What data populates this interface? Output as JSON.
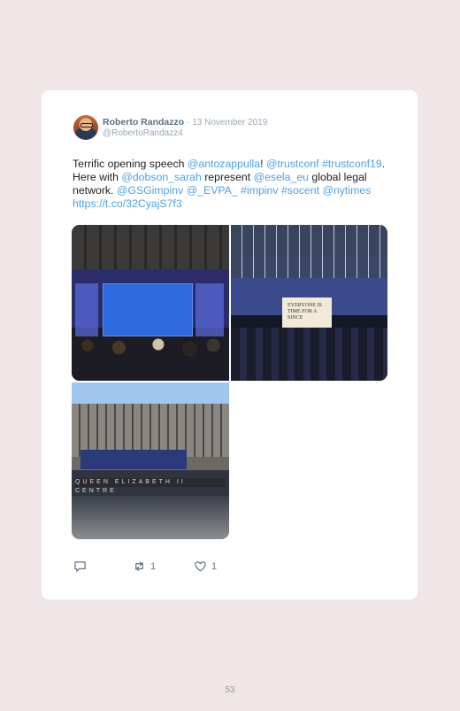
{
  "tweet": {
    "author_name": "Roberto Randazzo",
    "date": "· 13 November 2019",
    "handle": "@RobertoRandazz4",
    "text_parts": [
      {
        "t": "Terrific opening speech ",
        "link": false
      },
      {
        "t": "@antozappulla",
        "link": true
      },
      {
        "t": "! ",
        "link": false
      },
      {
        "t": "@trustconf",
        "link": true
      },
      {
        "t": " ",
        "link": false
      },
      {
        "t": "#trustconf19",
        "link": true
      },
      {
        "t": ". Here with ",
        "link": false
      },
      {
        "t": "@dobson_sarah",
        "link": true
      },
      {
        "t": " represent ",
        "link": false
      },
      {
        "t": "@esela_eu",
        "link": true
      },
      {
        "t": " global legal network. ",
        "link": false
      },
      {
        "t": "@GSGimpinv",
        "link": true
      },
      {
        "t": " ",
        "link": false
      },
      {
        "t": "@_EVPA_",
        "link": true
      },
      {
        "t": " ",
        "link": false
      },
      {
        "t": "#impinv",
        "link": true
      },
      {
        "t": " ",
        "link": false
      },
      {
        "t": "#socent",
        "link": true
      },
      {
        "t": " ",
        "link": false
      },
      {
        "t": "@nytimes",
        "link": true
      },
      {
        "t": " ",
        "link": false
      },
      {
        "t": "https://t.co/32CyajS7f3",
        "link": true
      }
    ],
    "retweet_count": "1",
    "like_count": "1"
  },
  "photos": {
    "p2_screen_text": "EVERYONE IS\nTIME FOR A\nSINCE"
  },
  "icons": {
    "reply": "reply-icon",
    "retweet": "retweet-icon",
    "like": "heart-icon"
  },
  "colors": {
    "link": "#4ea1e6",
    "name": "#5a6f84",
    "meta": "#9aa7b3"
  },
  "page_number": "53"
}
